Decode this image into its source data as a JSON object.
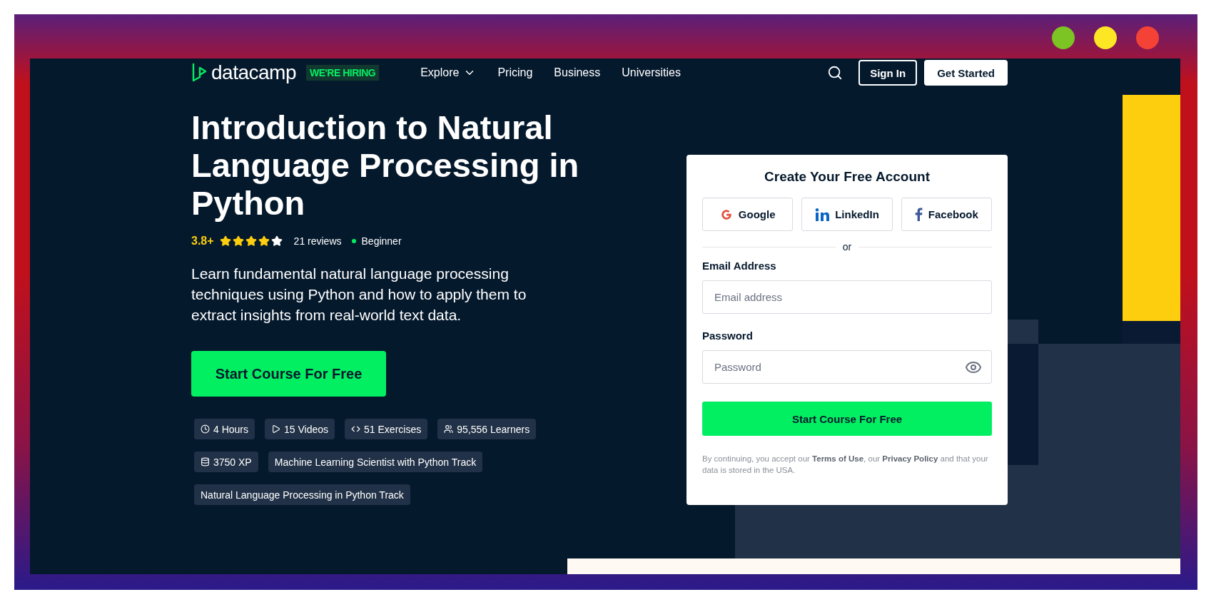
{
  "window": {
    "controls": [
      {
        "color": "#7cc324"
      },
      {
        "color": "#fde725"
      },
      {
        "color": "#f44336"
      }
    ]
  },
  "nav": {
    "logo": "datacamp",
    "badge": "WE'RE HIRING",
    "links": [
      {
        "label": "Explore",
        "dropdown": true
      },
      {
        "label": "Pricing",
        "dropdown": false
      },
      {
        "label": "Business",
        "dropdown": false
      },
      {
        "label": "Universities",
        "dropdown": false
      }
    ],
    "sign_in": "Sign In",
    "get_started": "Get Started"
  },
  "course": {
    "title": "Introduction to Natural Language Processing in Python",
    "rating": "3.8+",
    "stars": 4,
    "reviews": "21 reviews",
    "level": "Beginner",
    "description": "Learn fundamental natural language processing techniques using Python and how to apply them to extract insights from real-world text data.",
    "cta": "Start Course For Free",
    "stats": [
      [
        {
          "kind": "clock",
          "label": "4 Hours"
        },
        {
          "kind": "play",
          "label": "15 Videos"
        },
        {
          "kind": "code",
          "label": "51 Exercises"
        },
        {
          "kind": "users",
          "label": "95,556 Learners"
        }
      ],
      [
        {
          "kind": "database",
          "label": "3750 XP"
        },
        {
          "kind": "track",
          "label": "Machine Learning Scientist with Python Track"
        }
      ],
      [
        {
          "kind": "track",
          "label": "Natural Language Processing in Python Track"
        }
      ]
    ]
  },
  "signup": {
    "title": "Create Your Free Account",
    "social": [
      {
        "kind": "google",
        "label": "Google"
      },
      {
        "kind": "linkedin",
        "label": "LinkedIn"
      },
      {
        "kind": "facebook",
        "label": "Facebook"
      }
    ],
    "divider": "or",
    "email_label": "Email Address",
    "email_placeholder": "Email address",
    "password_label": "Password",
    "password_placeholder": "Password",
    "submit": "Start Course For Free",
    "legal": "By continuing, you accept our **Terms of Use**, our **Privacy Policy** and that your data is stored in the USA."
  }
}
